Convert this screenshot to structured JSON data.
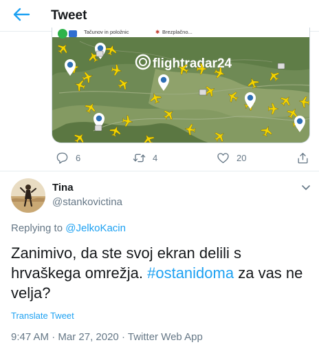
{
  "header": {
    "title": "Tweet",
    "back_icon": "arrow-left-icon",
    "accent": "#1da1f2"
  },
  "quoted_media": {
    "strip_text": "Tačunov in položnic",
    "strip_text_2": "Brezplačno...",
    "watermark": "flightradar24"
  },
  "actions": {
    "replies": "6",
    "retweets": "4",
    "likes": "20"
  },
  "reply": {
    "name": "Tina",
    "handle": "@stankovictina",
    "replying_prefix": "Replying to",
    "replying_to": "@JelkoKacin",
    "text_part1": "Zanimivo, da ste svoj ekran delili s hrvaškega omrežja.",
    "hashtag": "#ostanidoma",
    "text_part2": "za vas ne velja?",
    "translate_label": "Translate Tweet",
    "time": "9:47 AM",
    "date": "Mar 27, 2020",
    "app": "Twitter Web App"
  }
}
